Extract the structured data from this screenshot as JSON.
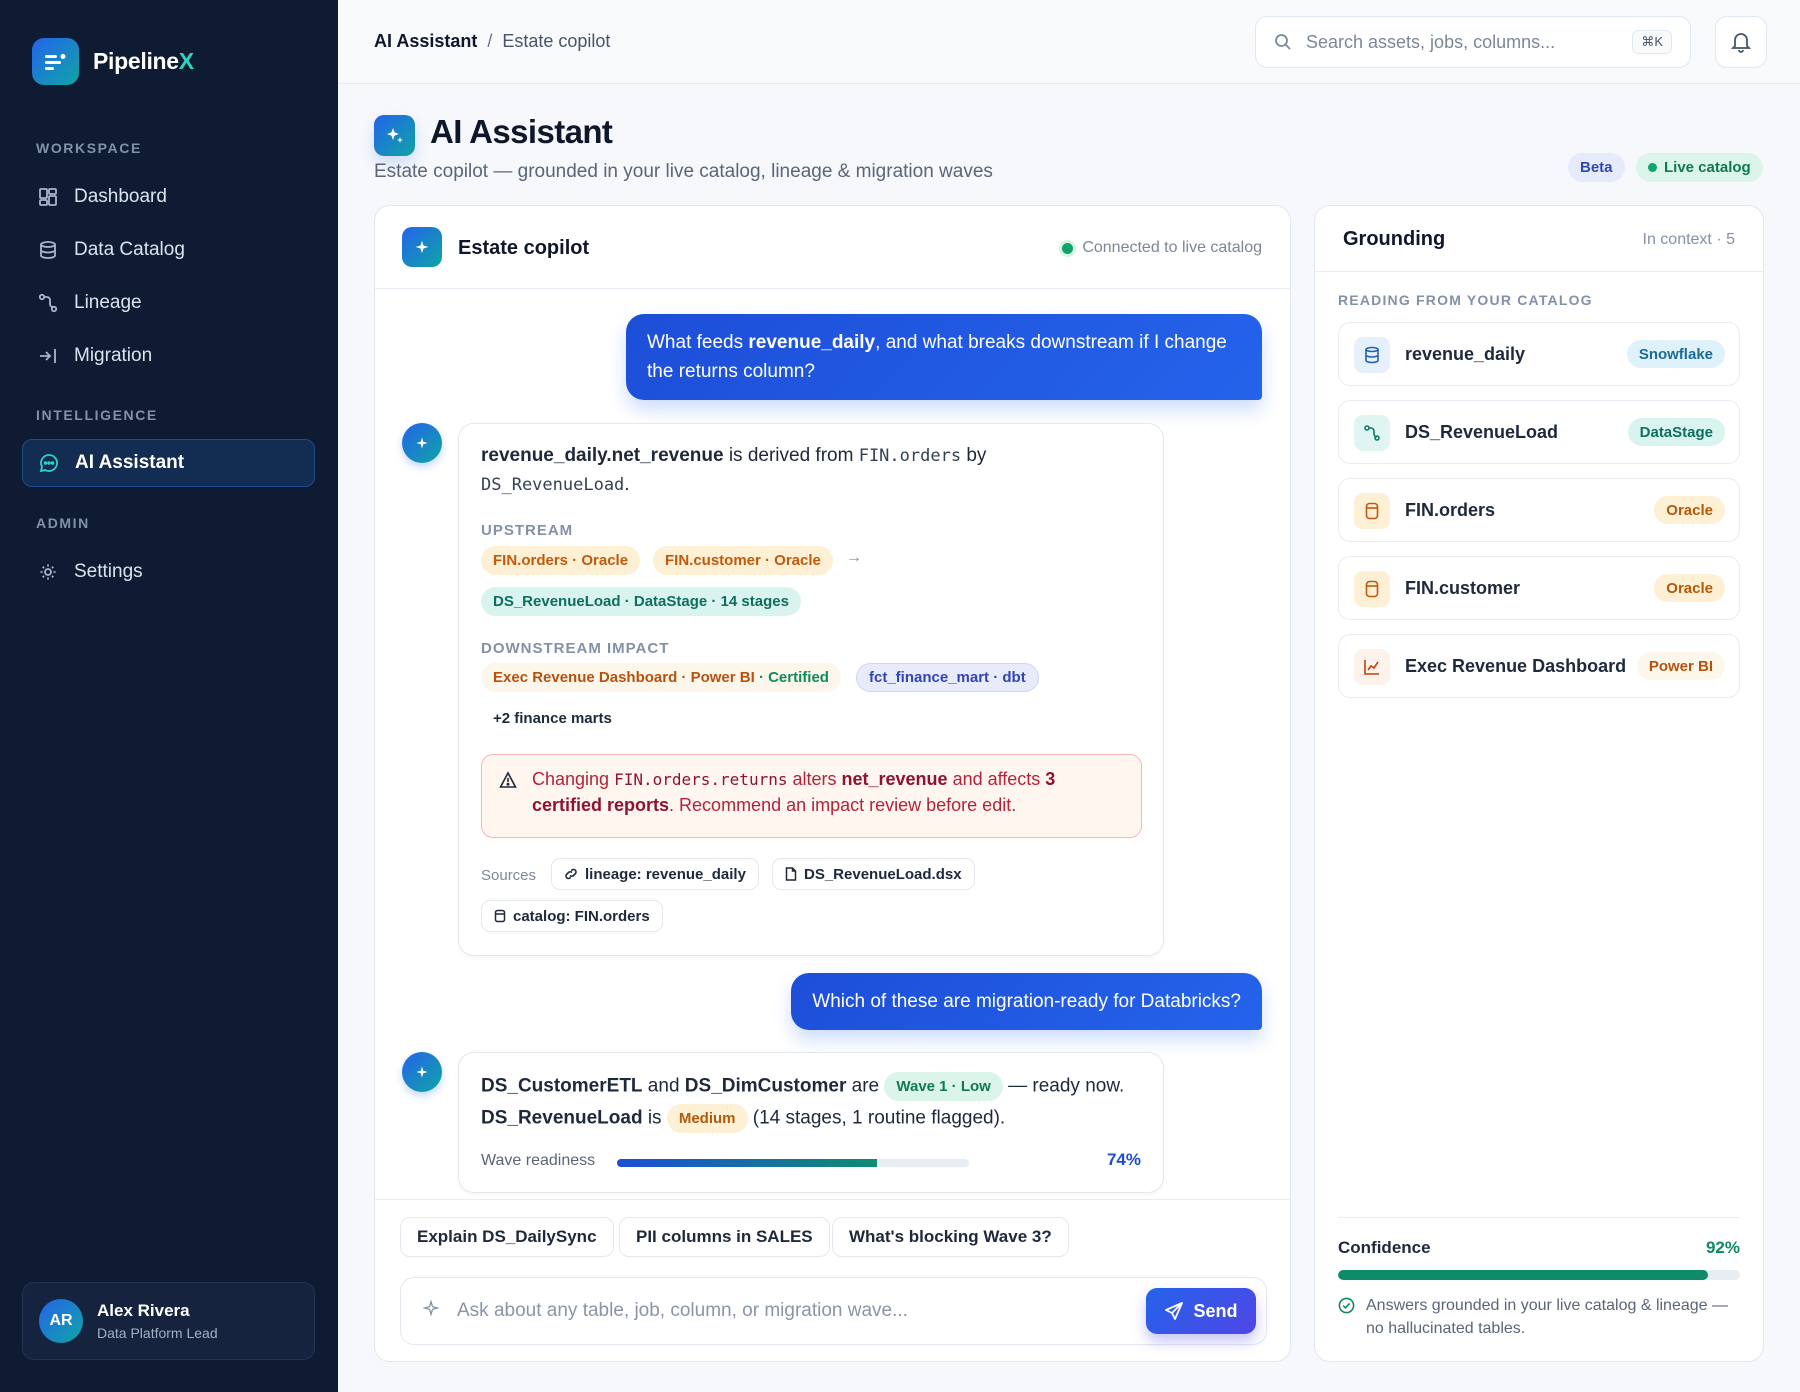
{
  "app": {
    "name_main": "Pipeline",
    "name_accent": "X"
  },
  "sidebar": {
    "sections": [
      "WORKSPACE",
      "INTELLIGENCE",
      "ADMIN"
    ],
    "items": [
      {
        "label": "Dashboard",
        "icon": "dashboard-icon"
      },
      {
        "label": "Data Catalog",
        "icon": "database-icon"
      },
      {
        "label": "Lineage",
        "icon": "lineage-icon"
      },
      {
        "label": "Migration",
        "icon": "migration-icon"
      },
      {
        "label": "AI Assistant",
        "icon": "chat-icon",
        "active": true
      },
      {
        "label": "Settings",
        "icon": "gear-icon"
      }
    ],
    "user": {
      "initials": "AR",
      "name": "Alex Rivera",
      "role": "Data Platform Lead"
    }
  },
  "topbar": {
    "breadcrumb": [
      "AI Assistant",
      "/",
      "Estate copilot"
    ],
    "search_placeholder": "Search assets, jobs, columns...",
    "search_shortcut": "⌘K"
  },
  "page": {
    "title": "AI Assistant",
    "subtitle": "Estate copilot — grounded in your live catalog, lineage & migration waves",
    "badge_beta": "Beta",
    "badge_live": "Live catalog"
  },
  "chat": {
    "title": "Estate copilot",
    "status": "Connected to live catalog",
    "q1": {
      "pre": "What feeds ",
      "bold": "revenue_daily",
      "post": ", and what breaks downstream if I change",
      "line2": "the returns column?"
    },
    "a1": {
      "line1_bold": "revenue_daily.net_revenue",
      "line1_mid": " is derived from ",
      "line1_code": "FIN.orders",
      "line1_end": " by",
      "line2_code": "DS_RevenueLoad",
      "line2_end": ".",
      "upstream_label": "UPSTREAM",
      "upstream": [
        "FIN.orders · Oracle",
        "FIN.customer · Oracle"
      ],
      "arrow": "→",
      "upstream_job": "DS_RevenueLoad · DataStage · 14 stages",
      "downstream_label": "DOWNSTREAM IMPACT",
      "downstream_exec": "Exec Revenue Dashboard · Power BI",
      "downstream_cert": "· Certified",
      "downstream_dbt": "fct_finance_mart · dbt",
      "downstream_more": "+2 finance marts",
      "warning": {
        "pre": "Changing ",
        "code": "FIN.orders.returns",
        "mid": " alters ",
        "bold1": "net_revenue",
        "mid2": " and affects ",
        "bold2": "3",
        "line2_bold": "certified reports",
        "line2_end": ". Recommend an impact review before edit."
      },
      "sources_label": "Sources",
      "sources": [
        "lineage: revenue_daily",
        "DS_RevenueLoad.dsx",
        "catalog: FIN.orders"
      ]
    },
    "q2": "Which of these are migration-ready for Databricks?",
    "a2": {
      "b1": "DS_CustomerETL",
      "and": " and ",
      "b2": "DS_DimCustomer",
      "are": " are ",
      "chip1": "Wave 1 · Low",
      "ready": " — ready now.",
      "b3": "DS_RevenueLoad",
      "is": " is ",
      "chip2": "Medium",
      "tail": " (14 stages, 1 routine flagged).",
      "wave_label": "Wave readiness",
      "wave_pct": "74%",
      "wave_value": 0.74
    },
    "suggestions": [
      "Explain DS_DailySync",
      "PII columns in SALES",
      "What's blocking Wave 3?"
    ],
    "input_placeholder": "Ask about any table, job, column, or migration wave...",
    "send_label": "Send"
  },
  "grounding": {
    "title": "Grounding",
    "context": "In context · 5",
    "section": "READING FROM YOUR CATALOG",
    "items": [
      {
        "name": "revenue_daily",
        "tag": "Snowflake",
        "icon": "database-icon"
      },
      {
        "name": "DS_RevenueLoad",
        "tag": "DataStage",
        "icon": "pipeline-icon"
      },
      {
        "name": "FIN.orders",
        "tag": "Oracle",
        "icon": "table-icon"
      },
      {
        "name": "FIN.customer",
        "tag": "Oracle",
        "icon": "table-icon"
      },
      {
        "name": "Exec Revenue Dashboard",
        "tag": "Power BI",
        "icon": "chart-icon"
      }
    ],
    "confidence_label": "Confidence",
    "confidence_pct": "92%",
    "confidence_value": 0.92,
    "note": "Answers grounded in your live catalog & lineage — no hallucinated tables."
  },
  "colors": {
    "accent": "#2563eb",
    "teal": "#0ea5a4",
    "sidebar": "#0f1b33",
    "success": "#0f8b5d"
  }
}
